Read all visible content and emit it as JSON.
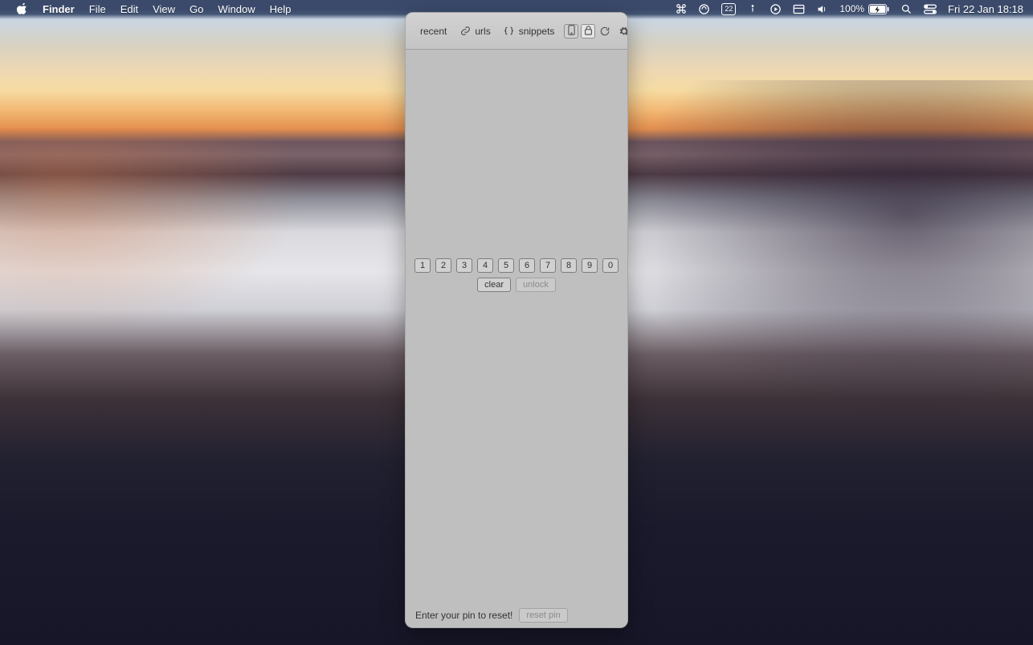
{
  "menubar": {
    "app": "Finder",
    "items": [
      "File",
      "Edit",
      "View",
      "Go",
      "Window",
      "Help"
    ],
    "status": {
      "cal_day": "22",
      "battery_pct": "100%",
      "clock": "Fri 22 Jan  18:18"
    },
    "icons": {
      "apple": "apple-logo",
      "cmd": "command-icon",
      "swirl": "swirl-icon",
      "calendar": "calendar-icon",
      "info": "info-icon",
      "play": "play-circle-icon",
      "layout": "layout-icon",
      "volume": "volume-icon",
      "battery": "battery-icon",
      "search": "search-icon",
      "control": "control-center-icon"
    }
  },
  "popover": {
    "tabs": {
      "recent": "recent",
      "urls": "urls",
      "snippets": "snippets"
    },
    "icons": {
      "link": "link-icon",
      "braces": "braces-icon",
      "phone": "phone-icon",
      "lock": "lock-icon",
      "refresh": "refresh-icon",
      "gear": "gear-icon"
    },
    "pin": {
      "digits": [
        "1",
        "2",
        "3",
        "4",
        "5",
        "6",
        "7",
        "8",
        "9",
        "0"
      ],
      "clear": "clear",
      "unlock": "unlock"
    },
    "footer": {
      "prompt": "Enter your pin to reset!",
      "reset": "reset pin"
    }
  }
}
